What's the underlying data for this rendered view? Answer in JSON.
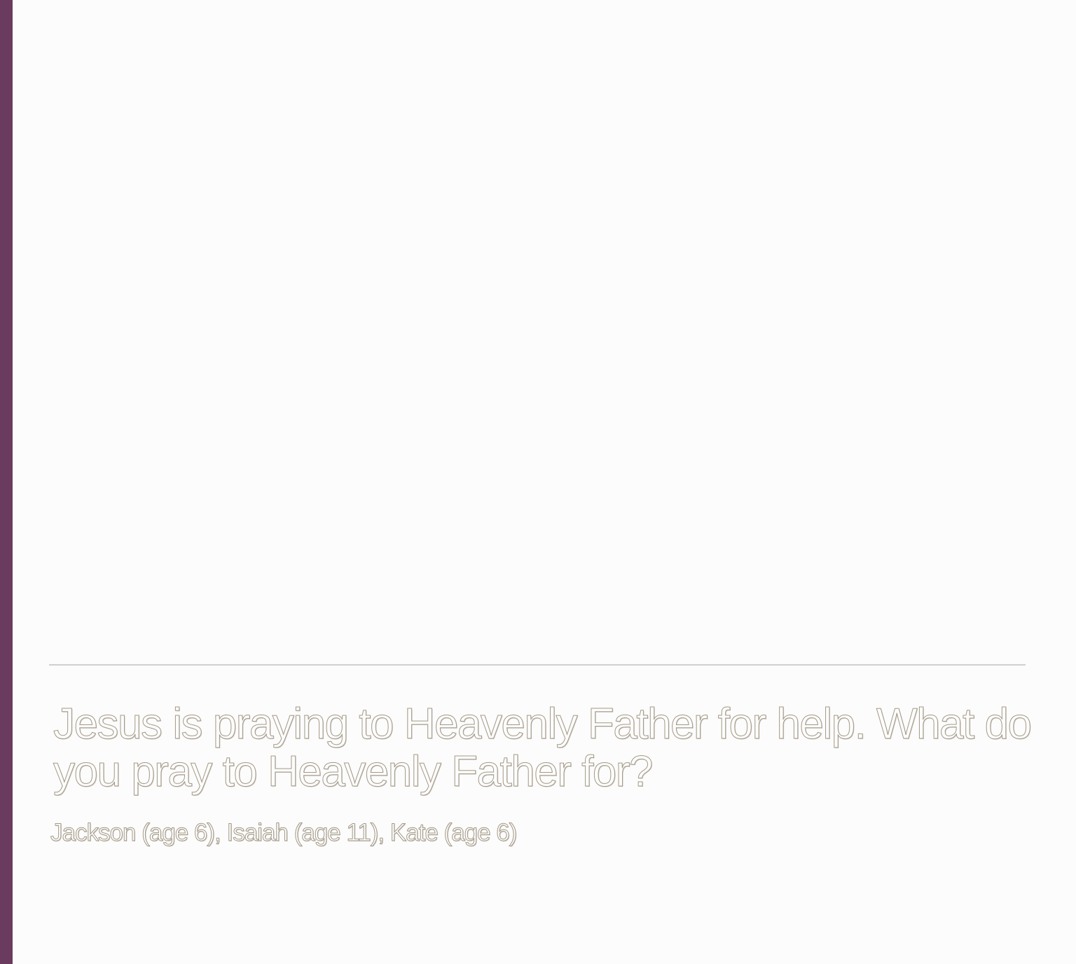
{
  "colors": {
    "accent": "#6b3a5f",
    "background": "#fcfcfc",
    "divider": "#cfcfcf",
    "text_outline": "#a49a86"
  },
  "caption": {
    "text": "Jesus is praying to Heavenly Father for help. What do you pray to Heavenly Father for?"
  },
  "credits": {
    "text": "Jackson (age 6), Isaiah (age 11), Kate (age 6)"
  }
}
